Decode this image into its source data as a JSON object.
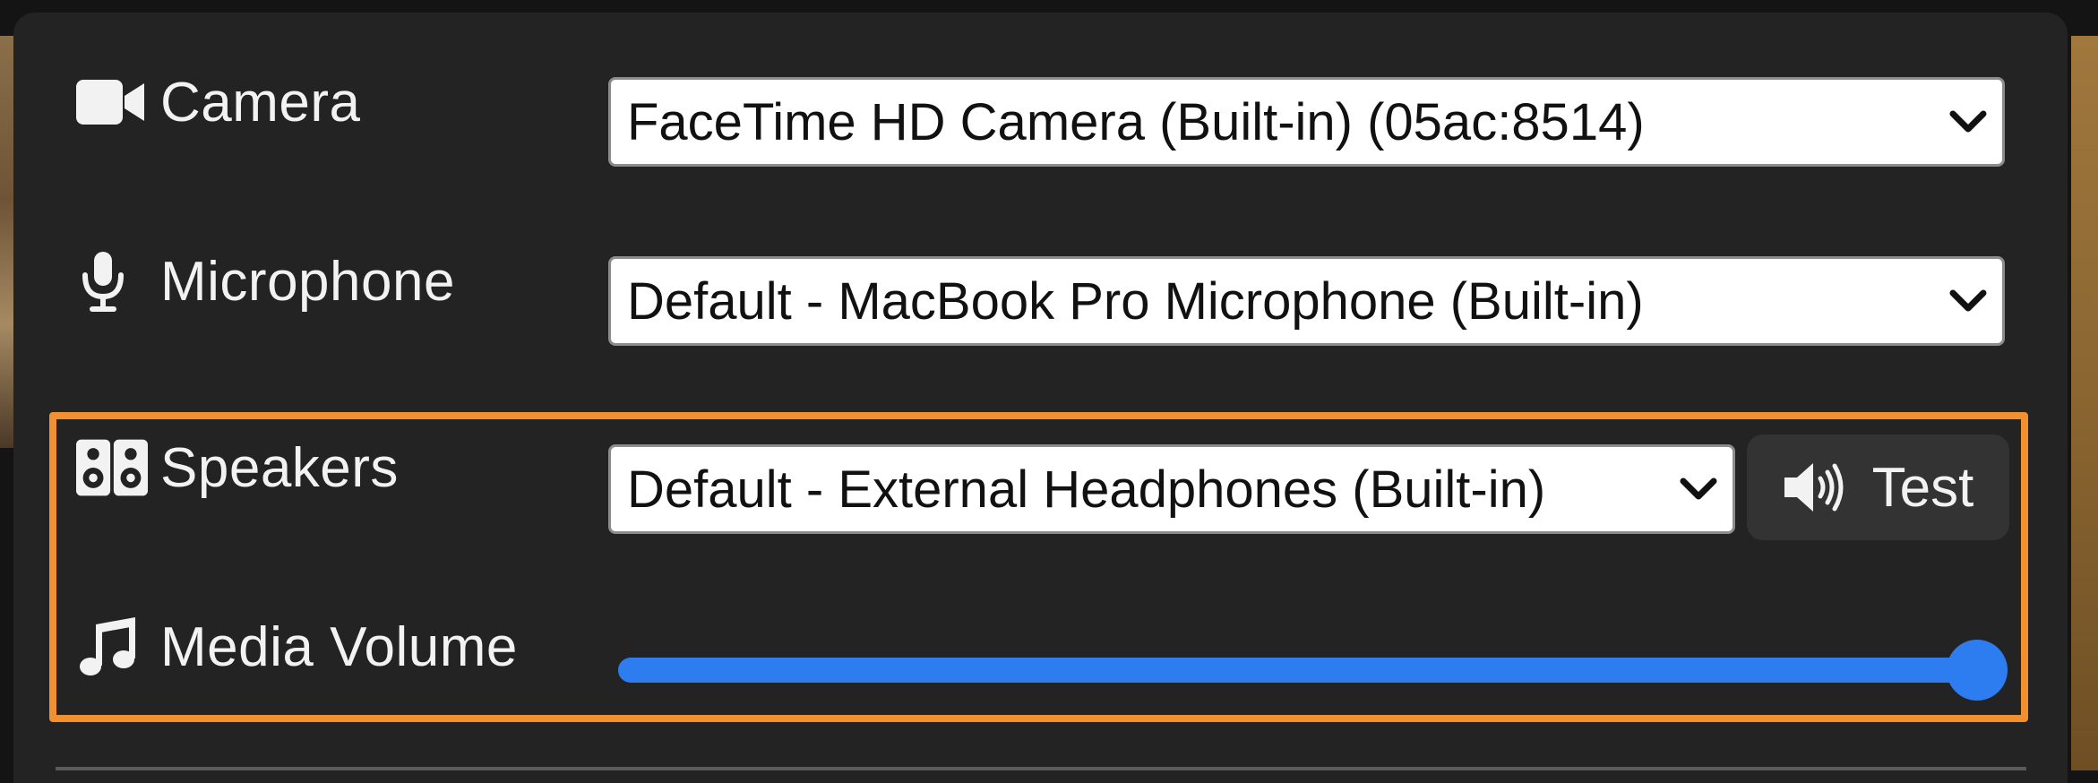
{
  "settings": {
    "camera": {
      "label": "Camera",
      "icon": "video-camera-icon",
      "selected": "FaceTime HD Camera (Built-in) (05ac:8514)"
    },
    "microphone": {
      "label": "Microphone",
      "icon": "microphone-icon",
      "selected": "Default - MacBook Pro Microphone (Built-in)"
    },
    "speakers": {
      "label": "Speakers",
      "icon": "speakers-icon",
      "selected": "Default - External Headphones (Built-in)",
      "test_button_label": "Test",
      "test_button_icon": "volume-up-icon"
    },
    "media_volume": {
      "label": "Media Volume",
      "icon": "music-note-icon",
      "value_fraction": 1.0
    }
  },
  "colors": {
    "panel_bg": "#232323",
    "highlight": "#f0902f",
    "slider_accent": "#2d7cf0",
    "select_bg": "#ffffff",
    "text": "#f2f2f2"
  }
}
